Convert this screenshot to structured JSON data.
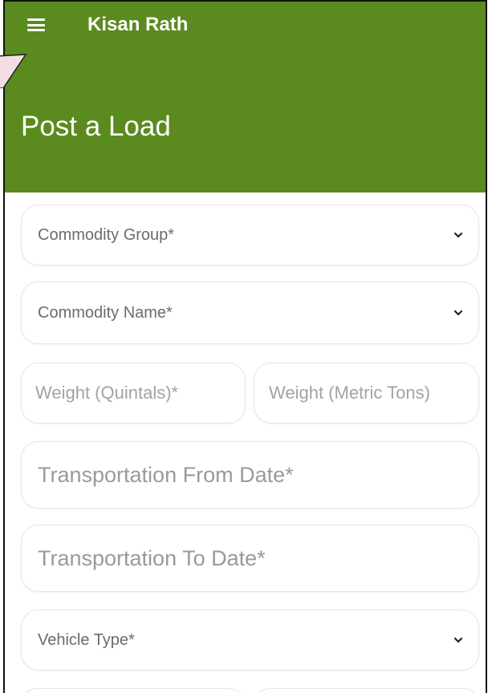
{
  "app": {
    "title": "Kisan Rath"
  },
  "page": {
    "title": "Post a Load"
  },
  "form": {
    "commodity_group": {
      "placeholder": "Commodity Group*"
    },
    "commodity_name": {
      "placeholder": "Commodity Name*"
    },
    "weight_quintals": {
      "placeholder": "Weight (Quintals)*"
    },
    "weight_metric_tons": {
      "placeholder": "Weight (Metric Tons)"
    },
    "from_date": {
      "placeholder": "Transportation From Date*"
    },
    "to_date": {
      "placeholder": "Transportation To Date*"
    },
    "vehicle_type": {
      "placeholder": "Vehicle Type*"
    }
  },
  "icons": {
    "menu": "hamburger-menu-icon",
    "dropdown": "chevron-down-icon"
  },
  "colors": {
    "header_green": "#5b8a1f",
    "callout_fill": "#f5dde6"
  }
}
